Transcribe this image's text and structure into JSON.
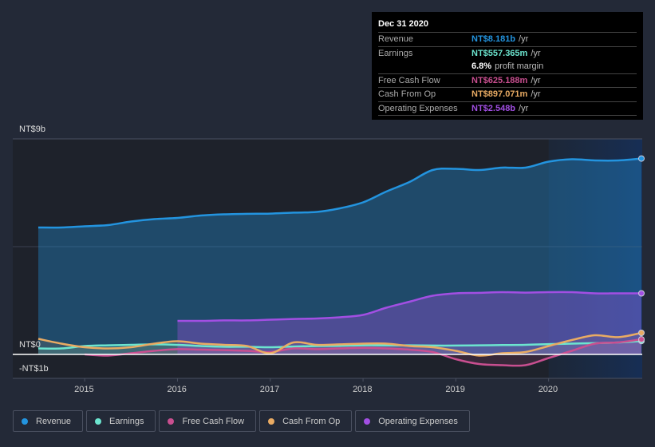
{
  "tooltip": {
    "date": "Dec 31 2020",
    "rows": [
      {
        "label": "Revenue",
        "value": "NT$8.181b",
        "unit": "/yr",
        "color": "#2394df"
      },
      {
        "label": "Earnings",
        "value": "NT$557.365m",
        "unit": "/yr",
        "color": "#6ce5cf"
      },
      {
        "label": "",
        "value": "6.8%",
        "unit": "profit margin",
        "color": "#ffffff"
      },
      {
        "label": "Free Cash Flow",
        "value": "NT$625.188m",
        "unit": "/yr",
        "color": "#c94f90"
      },
      {
        "label": "Cash From Op",
        "value": "NT$897.071m",
        "unit": "/yr",
        "color": "#e9ab63"
      },
      {
        "label": "Operating Expenses",
        "value": "NT$2.548b",
        "unit": "/yr",
        "color": "#a24fe3"
      }
    ]
  },
  "chart_data": {
    "type": "line",
    "title": "",
    "xlabel": "",
    "ylabel": "",
    "y_tick_labels": [
      "NT$9b",
      "NT$0",
      "-NT$1b"
    ],
    "x_tick_labels": [
      "2015",
      "2016",
      "2017",
      "2018",
      "2019",
      "2020"
    ],
    "ylim": [
      -1,
      9
    ],
    "xlim": [
      2014.5,
      2021.0
    ],
    "highlight_from": 2020.0,
    "legend_position": "bottom-left",
    "series": [
      {
        "name": "Revenue",
        "color": "#2394df",
        "x": [
          2014.5,
          2014.75,
          2015.0,
          2015.25,
          2015.5,
          2015.75,
          2016.0,
          2016.25,
          2016.5,
          2016.75,
          2017.0,
          2017.25,
          2017.5,
          2017.75,
          2018.0,
          2018.25,
          2018.5,
          2018.75,
          2019.0,
          2019.25,
          2019.5,
          2019.75,
          2020.0,
          2020.25,
          2020.5,
          2020.75,
          2021.0
        ],
        "values": [
          5.3,
          5.3,
          5.35,
          5.4,
          5.55,
          5.65,
          5.7,
          5.8,
          5.85,
          5.87,
          5.88,
          5.92,
          5.95,
          6.1,
          6.35,
          6.8,
          7.2,
          7.7,
          7.75,
          7.7,
          7.8,
          7.8,
          8.05,
          8.15,
          8.1,
          8.1,
          8.18
        ]
      },
      {
        "name": "Earnings",
        "color": "#6ce5cf",
        "x": [
          2014.5,
          2014.75,
          2015.0,
          2015.25,
          2015.5,
          2015.75,
          2016.0,
          2016.25,
          2016.5,
          2016.75,
          2017.0,
          2017.25,
          2017.5,
          2017.75,
          2018.0,
          2018.25,
          2018.5,
          2018.75,
          2019.0,
          2019.25,
          2019.5,
          2019.75,
          2020.0,
          2020.25,
          2020.5,
          2020.75,
          2021.0
        ],
        "values": [
          0.25,
          0.25,
          0.35,
          0.38,
          0.4,
          0.42,
          0.4,
          0.35,
          0.32,
          0.32,
          0.3,
          0.33,
          0.35,
          0.36,
          0.38,
          0.38,
          0.38,
          0.37,
          0.37,
          0.38,
          0.39,
          0.4,
          0.43,
          0.45,
          0.47,
          0.5,
          0.56
        ]
      },
      {
        "name": "Free Cash Flow",
        "color": "#c94f90",
        "x": [
          2015.0,
          2015.25,
          2015.5,
          2015.75,
          2016.0,
          2016.25,
          2016.5,
          2016.75,
          2017.0,
          2017.25,
          2017.5,
          2017.75,
          2018.0,
          2018.25,
          2018.5,
          2018.75,
          2019.0,
          2019.25,
          2019.5,
          2019.75,
          2020.0,
          2020.25,
          2020.5,
          2020.75,
          2021.0
        ],
        "values": [
          0.0,
          -0.05,
          0.05,
          0.15,
          0.22,
          0.2,
          0.18,
          0.15,
          0.1,
          0.25,
          0.22,
          0.25,
          0.27,
          0.25,
          0.2,
          0.1,
          -0.2,
          -0.4,
          -0.45,
          -0.45,
          -0.15,
          0.15,
          0.45,
          0.5,
          0.63
        ]
      },
      {
        "name": "Cash From Op",
        "color": "#e9ab63",
        "x": [
          2014.5,
          2014.75,
          2015.0,
          2015.25,
          2015.5,
          2015.75,
          2016.0,
          2016.25,
          2016.5,
          2016.75,
          2017.0,
          2017.25,
          2017.5,
          2017.75,
          2018.0,
          2018.25,
          2018.5,
          2018.75,
          2019.0,
          2019.25,
          2019.5,
          2019.75,
          2020.0,
          2020.25,
          2020.5,
          2020.75,
          2021.0
        ],
        "values": [
          0.65,
          0.45,
          0.3,
          0.25,
          0.3,
          0.45,
          0.55,
          0.45,
          0.4,
          0.35,
          0.05,
          0.5,
          0.4,
          0.42,
          0.45,
          0.45,
          0.35,
          0.3,
          0.15,
          -0.05,
          0.05,
          0.1,
          0.35,
          0.6,
          0.8,
          0.72,
          0.9
        ]
      },
      {
        "name": "Operating Expenses",
        "color": "#a24fe3",
        "x": [
          2016.0,
          2016.25,
          2016.5,
          2016.75,
          2017.0,
          2017.25,
          2017.5,
          2017.75,
          2018.0,
          2018.25,
          2018.5,
          2018.75,
          2019.0,
          2019.25,
          2019.5,
          2019.75,
          2020.0,
          2020.25,
          2020.5,
          2020.75,
          2021.0
        ],
        "values": [
          1.4,
          1.4,
          1.42,
          1.42,
          1.45,
          1.48,
          1.5,
          1.55,
          1.65,
          1.95,
          2.2,
          2.45,
          2.55,
          2.57,
          2.6,
          2.58,
          2.6,
          2.6,
          2.55,
          2.55,
          2.55
        ]
      }
    ]
  },
  "legend": [
    {
      "label": "Revenue",
      "color": "#2394df"
    },
    {
      "label": "Earnings",
      "color": "#6ce5cf"
    },
    {
      "label": "Free Cash Flow",
      "color": "#c94f90"
    },
    {
      "label": "Cash From Op",
      "color": "#e9ab63"
    },
    {
      "label": "Operating Expenses",
      "color": "#a24fe3"
    }
  ]
}
